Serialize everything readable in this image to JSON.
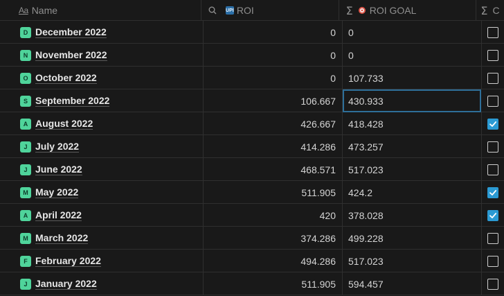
{
  "columns": {
    "name": {
      "label": "Name",
      "icon": "text-property-icon",
      "icon_glyph": "Aa"
    },
    "roi": {
      "label": "ROI",
      "icon_prefix": "search-icon",
      "badge": "UPI"
    },
    "roi_goal": {
      "label": "ROI GOAL",
      "icon": "sum-icon",
      "icon_glyph": "Σ"
    },
    "check": {
      "icon_glyph": "Σ",
      "label_fragment": "C"
    }
  },
  "rows": [
    {
      "badge": "D",
      "name": "December 2022",
      "roi": "0",
      "goal": "0",
      "checked": false
    },
    {
      "badge": "N",
      "name": "November 2022",
      "roi": "0",
      "goal": "0",
      "checked": false
    },
    {
      "badge": "O",
      "name": "October 2022",
      "roi": "0",
      "goal": "107.733",
      "checked": false
    },
    {
      "badge": "S",
      "name": "September 2022",
      "roi": "106.667",
      "goal": "430.933",
      "checked": false
    },
    {
      "badge": "A",
      "name": "August 2022",
      "roi": "426.667",
      "goal": "418.428",
      "checked": true
    },
    {
      "badge": "J",
      "name": "July 2022",
      "roi": "414.286",
      "goal": "473.257",
      "checked": false
    },
    {
      "badge": "J",
      "name": "June 2022",
      "roi": "468.571",
      "goal": "517.023",
      "checked": false
    },
    {
      "badge": "M",
      "name": "May 2022",
      "roi": "511.905",
      "goal": "424.2",
      "checked": true
    },
    {
      "badge": "A",
      "name": "April 2022",
      "roi": "420",
      "goal": "378.028",
      "checked": true
    },
    {
      "badge": "M",
      "name": "March 2022",
      "roi": "374.286",
      "goal": "499.228",
      "checked": false
    },
    {
      "badge": "F",
      "name": "February 2022",
      "roi": "494.286",
      "goal": "517.023",
      "checked": false
    },
    {
      "badge": "J",
      "name": "January 2022",
      "roi": "511.905",
      "goal": "594.457",
      "checked": false
    }
  ],
  "selected_cell": {
    "row_index": 3,
    "column": "goal"
  },
  "colors": {
    "background": "#191919",
    "badge": "#4fd49b",
    "checkbox_checked": "#2b9ad3",
    "selection": "#2e6f99"
  }
}
